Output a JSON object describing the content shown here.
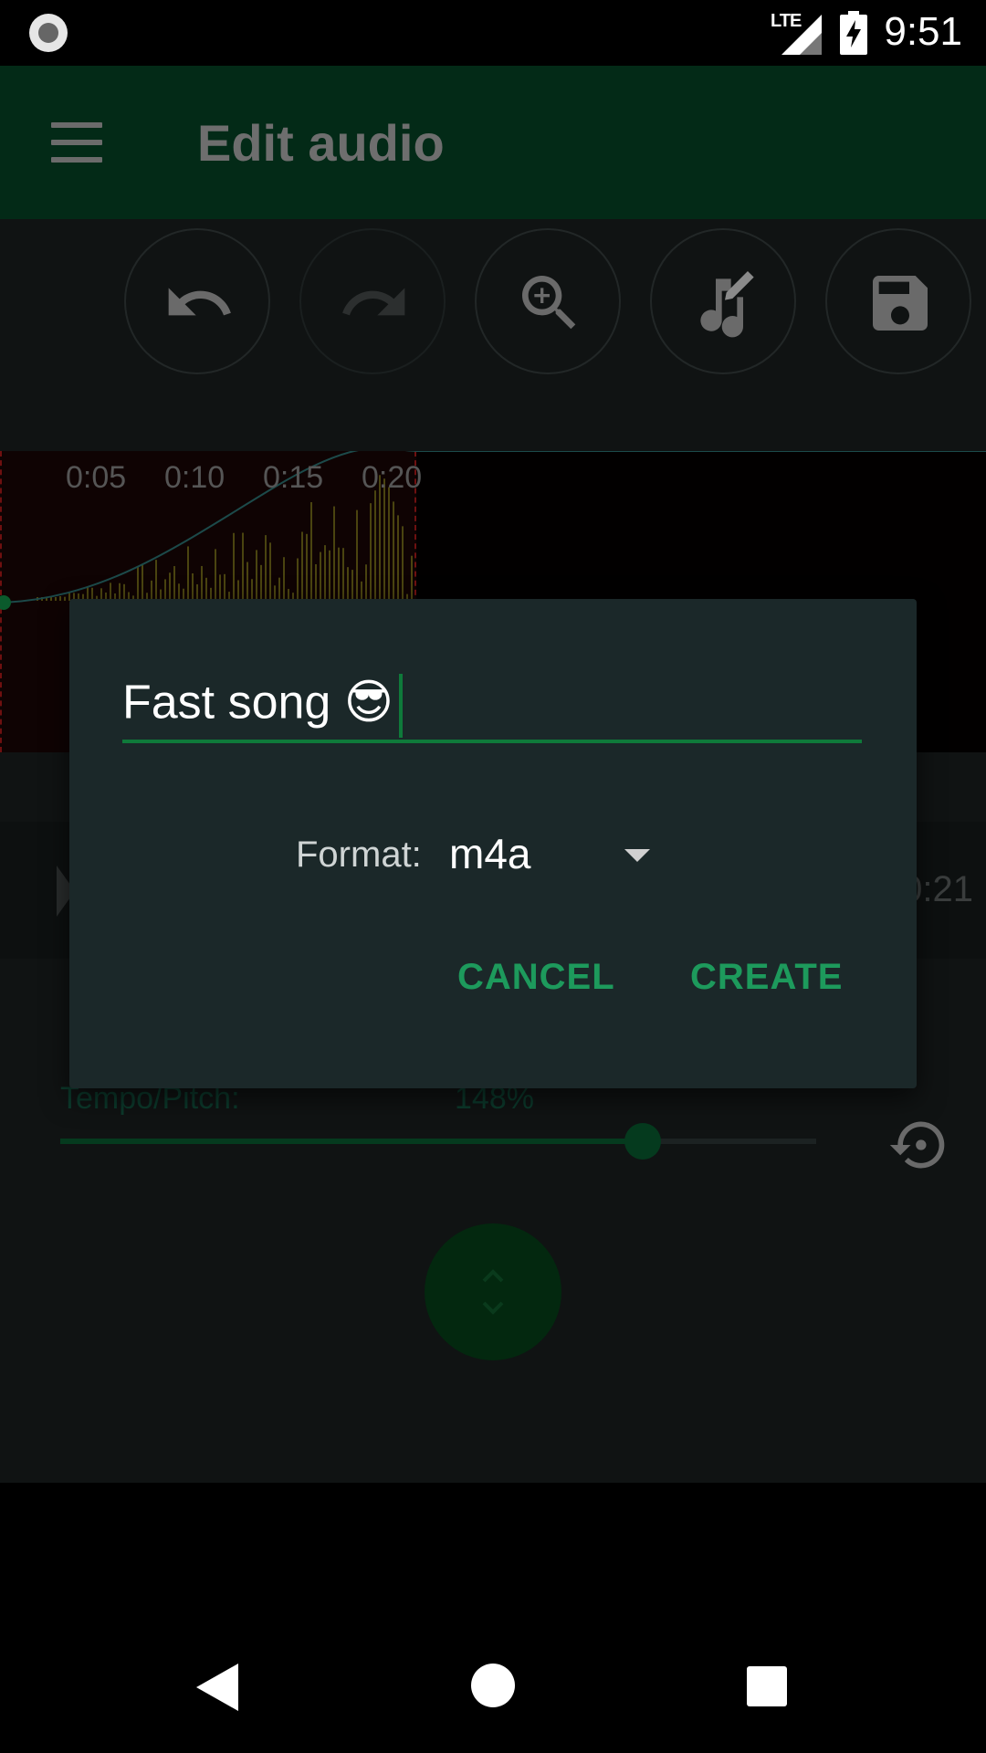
{
  "status_bar": {
    "network": "LTE",
    "time": "9:51",
    "icons": [
      "record-icon",
      "lte-signal-icon",
      "battery-charging-icon"
    ]
  },
  "app_bar": {
    "title": "Edit audio",
    "menu_icon": "menu-icon"
  },
  "toolbar": {
    "buttons": [
      {
        "name": "undo",
        "icon": "undo-icon",
        "enabled": true
      },
      {
        "name": "redo",
        "icon": "redo-icon",
        "enabled": false
      },
      {
        "name": "zoom-in",
        "icon": "zoom-in-icon",
        "enabled": true
      },
      {
        "name": "edit-music",
        "icon": "music-edit-icon",
        "enabled": true
      },
      {
        "name": "save",
        "icon": "save-icon",
        "enabled": true
      }
    ]
  },
  "waveform": {
    "ticks": [
      "0:05",
      "0:10",
      "0:15",
      "0:20"
    ]
  },
  "player": {
    "end_time": "0:21"
  },
  "tempo": {
    "label": "Tempo/Pitch:",
    "value_text": "148%",
    "slider_fraction": 0.77
  },
  "dialog": {
    "name_value": "Fast song 😎",
    "format_label": "Format:",
    "format_value": "m4a",
    "cancel_label": "CANCEL",
    "create_label": "CREATE"
  },
  "colors": {
    "accent": "#1d9a5c",
    "app_bar": "#032a17",
    "dialog_bg": "#1b2829"
  }
}
